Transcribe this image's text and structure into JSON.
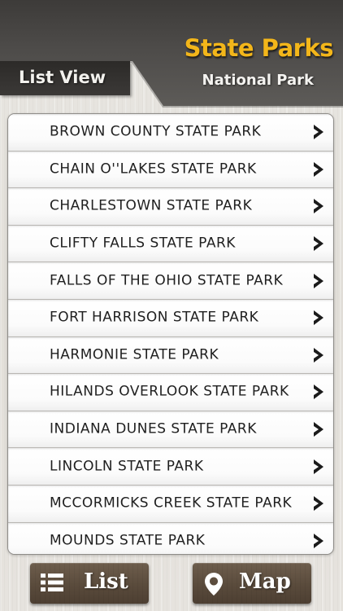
{
  "header": {
    "title": "State Parks",
    "subtitle": "National Park",
    "view_label": "List View"
  },
  "parks": [
    "BROWN COUNTY STATE PARK",
    "CHAIN O''LAKES STATE PARK",
    "CHARLESTOWN STATE PARK",
    "CLIFTY FALLS STATE PARK",
    "FALLS OF THE OHIO STATE PARK",
    "FORT HARRISON STATE PARK",
    "HARMONIE STATE PARK",
    "HILANDS OVERLOOK STATE PARK",
    "INDIANA DUNES STATE PARK",
    "LINCOLN STATE PARK",
    "MCCORMICKS CREEK STATE PARK",
    "MOUNDS STATE PARK"
  ],
  "footer": {
    "list_label": "List",
    "map_label": "Map"
  },
  "colors": {
    "title": "#f3b61a",
    "header_bg": "#4d4b49",
    "button_bg": "#5a4b3c"
  },
  "icons": {
    "row_chevron": "chevron-right-icon",
    "list_button": "list-icon",
    "map_button": "map-pin-icon"
  }
}
